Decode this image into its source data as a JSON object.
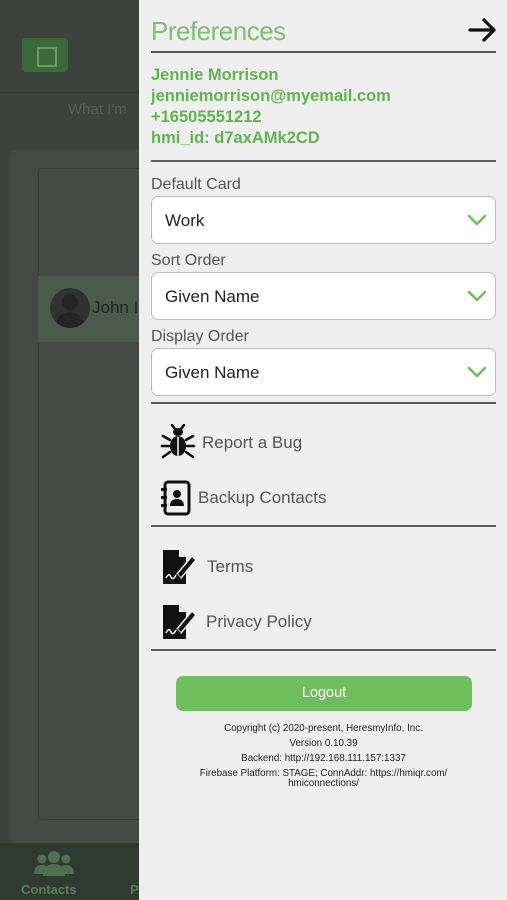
{
  "background": {
    "search_placeholder": "What I'm",
    "contact_name": "John I",
    "tab_contacts_label": "Contacts",
    "tab_second_label": "P"
  },
  "drawer": {
    "title": "Preferences",
    "close_icon": "arrow-right-icon",
    "user": {
      "name": "Jennie Morrison",
      "email": "jenniemorrison@myemail.com",
      "phone": "+16505551212",
      "hmi_id": "hmi_id: d7axAMk2CD"
    },
    "default_card": {
      "label": "Default Card",
      "value": "Work"
    },
    "sort_order": {
      "label": "Sort Order",
      "value": "Given Name"
    },
    "display_order": {
      "label": "Display Order",
      "value": "Given Name"
    },
    "menu": {
      "report_bug": {
        "label": "Report a Bug",
        "icon": "bug-icon"
      },
      "backup_contacts": {
        "label": "Backup Contacts",
        "icon": "contacts-book-icon"
      },
      "terms": {
        "label": "Terms",
        "icon": "document-sign-icon"
      },
      "privacy_policy": {
        "label": "Privacy Policy",
        "icon": "document-sign-icon"
      }
    },
    "logout_label": "Logout",
    "footer": {
      "copyright": "Copyright (c) 2020-present, HeresmyInfo, Inc.",
      "version": "Version 0.10.39",
      "backend": "Backend: http://192.168.111.157:1337",
      "firebase_line1": "Firebase Platform: STAGE; ConnAddr: https://hmiqr.com/",
      "firebase_line2": "hmiconnections/"
    }
  },
  "colors": {
    "accent_green": "#6fbe5e",
    "title_green": "#7fbf6e",
    "user_green": "#5fb54d",
    "drawer_bg": "#efefef"
  }
}
